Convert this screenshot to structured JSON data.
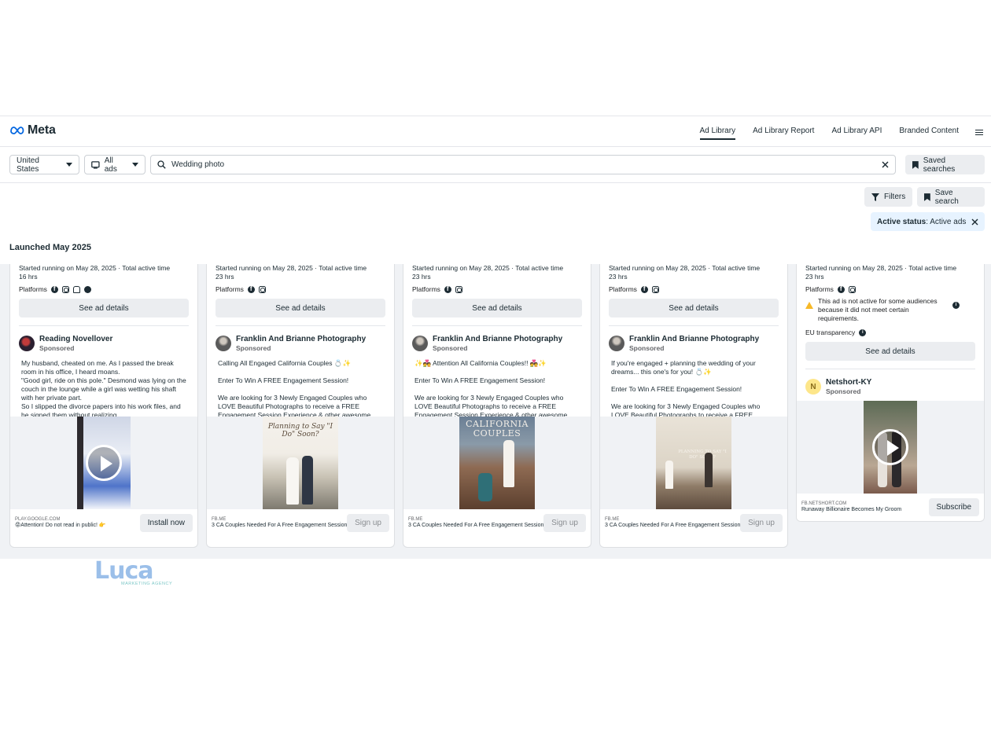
{
  "nav": {
    "brand": "Meta",
    "links": [
      "Ad Library",
      "Ad Library Report",
      "Ad Library API",
      "Branded Content"
    ],
    "active": "Ad Library"
  },
  "search": {
    "country": "United States",
    "ad_type": "All ads",
    "query": "Wedding photo",
    "saved_searches": "Saved searches"
  },
  "toolbar": {
    "filters": "Filters",
    "save_search": "Save search",
    "chip_label": "Active status",
    "chip_value": ": Active ads"
  },
  "section_title": "Launched May 2025",
  "common": {
    "platforms": "Platforms",
    "see_details": "See ad details",
    "sponsored": "Sponsored"
  },
  "cards": [
    {
      "started": "Started running on May 28, 2025 · Total active time",
      "duration": "16 hrs",
      "advertiser": "Reading Novellover",
      "body": "My husband, cheated on me. As I passed the break room in his office, I heard moans.\n\"Good girl, ride on this pole.\" Desmond was lying on the couch in the lounge while a girl was wetting his shaft with her private part.\nSo I slipped the divorce papers into his work files, and he signed them without realizing. ...",
      "domain": "PLAY.GOOGLE.COM",
      "footer_text": "😡Attention! Do not read in public! 👉",
      "cta": "Install now"
    },
    {
      "started": "Started running on May 28, 2025 · Total active time",
      "duration": "23 hrs",
      "advertiser": "Franklin And Brianne Photography",
      "body": "Calling All Engaged California Couples 💍✨\n\nEnter To Win A FREE Engagement Session!\n\nWe are looking for 3 Newly Engaged Couples who LOVE Beautiful Photographs to receive a FREE Engagement Session Experience & other awesome Wedding Photo an...",
      "image_text": "Planning to Say \"I Do\" Soon?",
      "domain": "FB.ME",
      "footer_text": "3 CA Couples Needed For A Free Engagement Session",
      "cta": "Sign up"
    },
    {
      "started": "Started running on May 28, 2025 · Total active time",
      "duration": "23 hrs",
      "advertiser": "Franklin And Brianne Photography",
      "body": "✨💑 Attention All California Couples!! 💑✨\n\nEnter To Win A FREE Engagement Session!\n\nWe are looking for 3 Newly Engaged Couples who LOVE Beautiful Photographs to receive a FREE Engagement Session Experience & other awesome Wedding Photo an...",
      "image_text": "CALIFORNIA COUPLES",
      "domain": "FB.ME",
      "footer_text": "3 CA Couples Needed For A Free Engagement Session",
      "cta": "Sign up"
    },
    {
      "started": "Started running on May 28, 2025 · Total active time",
      "duration": "23 hrs",
      "advertiser": "Franklin And Brianne Photography",
      "body": "If you're engaged + planning the wedding of your dreams... this one's for you! 💍✨\n\nEnter To Win A FREE Engagement Session!\n\nWe are looking for 3 Newly Engaged Couples who LOVE Beautiful Photographs to receive a FREE Engagement ...",
      "image_text": "PLANNING TO SAY \"I DO\" SOON?",
      "domain": "FB.ME",
      "footer_text": "3 CA Couples Needed For A Free Engagement Session",
      "cta": "Sign up"
    },
    {
      "started": "Started running on May 28, 2025 · Total active time",
      "duration": "23 hrs",
      "warning": "This ad is not active for some audiences because it did not meet certain requirements.",
      "eu": "EU transparency",
      "advertiser": "Netshort-KY",
      "avatar_letter": "N",
      "domain": "FB.NETSHORT.COM",
      "footer_text": "Runaway Billionaire Becomes My Groom",
      "cta": "Subscribe"
    }
  ],
  "watermark": {
    "name": "Luca",
    "tagline": "MARKETING AGENCY"
  },
  "colors": {
    "accent": "#1c2b33",
    "grey_bg": "#f0f2f5",
    "chip_bg": "#e7f3ff",
    "meta_blue": "#0668e1"
  }
}
